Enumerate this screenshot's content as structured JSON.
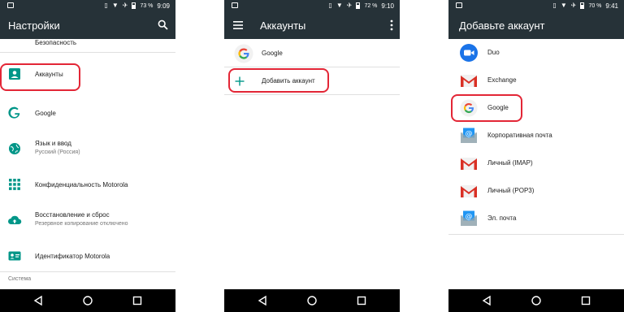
{
  "screens": [
    {
      "status": {
        "battery": "73 %",
        "time": "9:09"
      },
      "title": "Настройки",
      "items": [
        {
          "label": "Безопасность"
        },
        {
          "label": "Аккаунты"
        },
        {
          "label": "Google"
        },
        {
          "label": "Язык и ввод",
          "sub": "Русский (Россия)"
        },
        {
          "label": "Конфиденциальность Motorola"
        },
        {
          "label": "Восстановление и сброс",
          "sub": "Резервное копирование отключено"
        },
        {
          "label": "Идентификатор Motorola"
        }
      ],
      "section": "Система"
    },
    {
      "status": {
        "battery": "72 %",
        "time": "9:10"
      },
      "title": "Аккаунты",
      "items": [
        {
          "label": "Google"
        },
        {
          "label": "Добавить аккаунт"
        }
      ]
    },
    {
      "status": {
        "battery": "70 %",
        "time": "9:41"
      },
      "title": "Добавьте аккаунт",
      "items": [
        {
          "label": "Duo"
        },
        {
          "label": "Exchange"
        },
        {
          "label": "Google"
        },
        {
          "label": "Корпоративная почта"
        },
        {
          "label": "Личный (IMAP)"
        },
        {
          "label": "Личный (POP3)"
        },
        {
          "label": "Эл. почта"
        }
      ]
    }
  ],
  "colors": {
    "appbar": "#263238",
    "accent": "#009688",
    "highlight": "#e32636",
    "duo": "#1a73e8",
    "gmail_red": "#d93025"
  }
}
